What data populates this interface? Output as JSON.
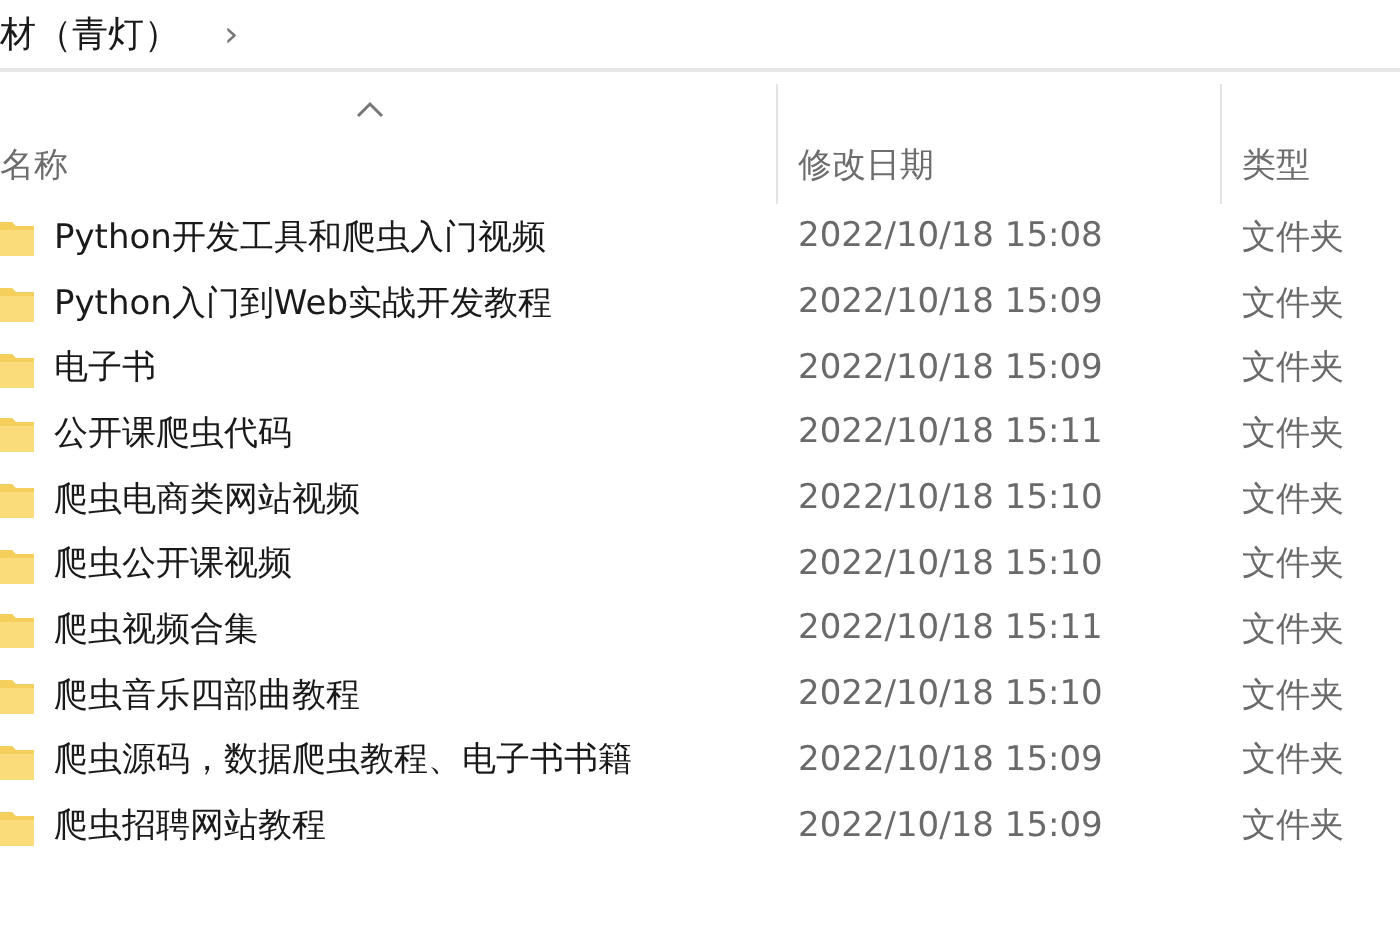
{
  "breadcrumb": {
    "items": [
      "材（青灯）"
    ],
    "separator": "›"
  },
  "table": {
    "columns": [
      {
        "label": "名称",
        "sorted": true
      },
      {
        "label": "修改日期",
        "sorted": false
      },
      {
        "label": "类型",
        "sorted": false
      }
    ],
    "rows": [
      {
        "name": "Python开发工具和爬虫入门视频",
        "modified": "2022/10/18 15:08",
        "type": "文件夹"
      },
      {
        "name": "Python入门到Web实战开发教程",
        "modified": "2022/10/18 15:09",
        "type": "文件夹"
      },
      {
        "name": "电子书",
        "modified": "2022/10/18 15:09",
        "type": "文件夹"
      },
      {
        "name": "公开课爬虫代码",
        "modified": "2022/10/18 15:11",
        "type": "文件夹"
      },
      {
        "name": "爬虫电商类网站视频",
        "modified": "2022/10/18 15:10",
        "type": "文件夹"
      },
      {
        "name": "爬虫公开课视频",
        "modified": "2022/10/18 15:10",
        "type": "文件夹"
      },
      {
        "name": "爬虫视频合集",
        "modified": "2022/10/18 15:11",
        "type": "文件夹"
      },
      {
        "name": "爬虫音乐四部曲教程",
        "modified": "2022/10/18 15:10",
        "type": "文件夹"
      },
      {
        "name": "爬虫源码，数据爬虫教程、电子书书籍",
        "modified": "2022/10/18 15:09",
        "type": "文件夹"
      },
      {
        "name": "爬虫招聘网站教程",
        "modified": "2022/10/18 15:09",
        "type": "文件夹"
      }
    ]
  }
}
